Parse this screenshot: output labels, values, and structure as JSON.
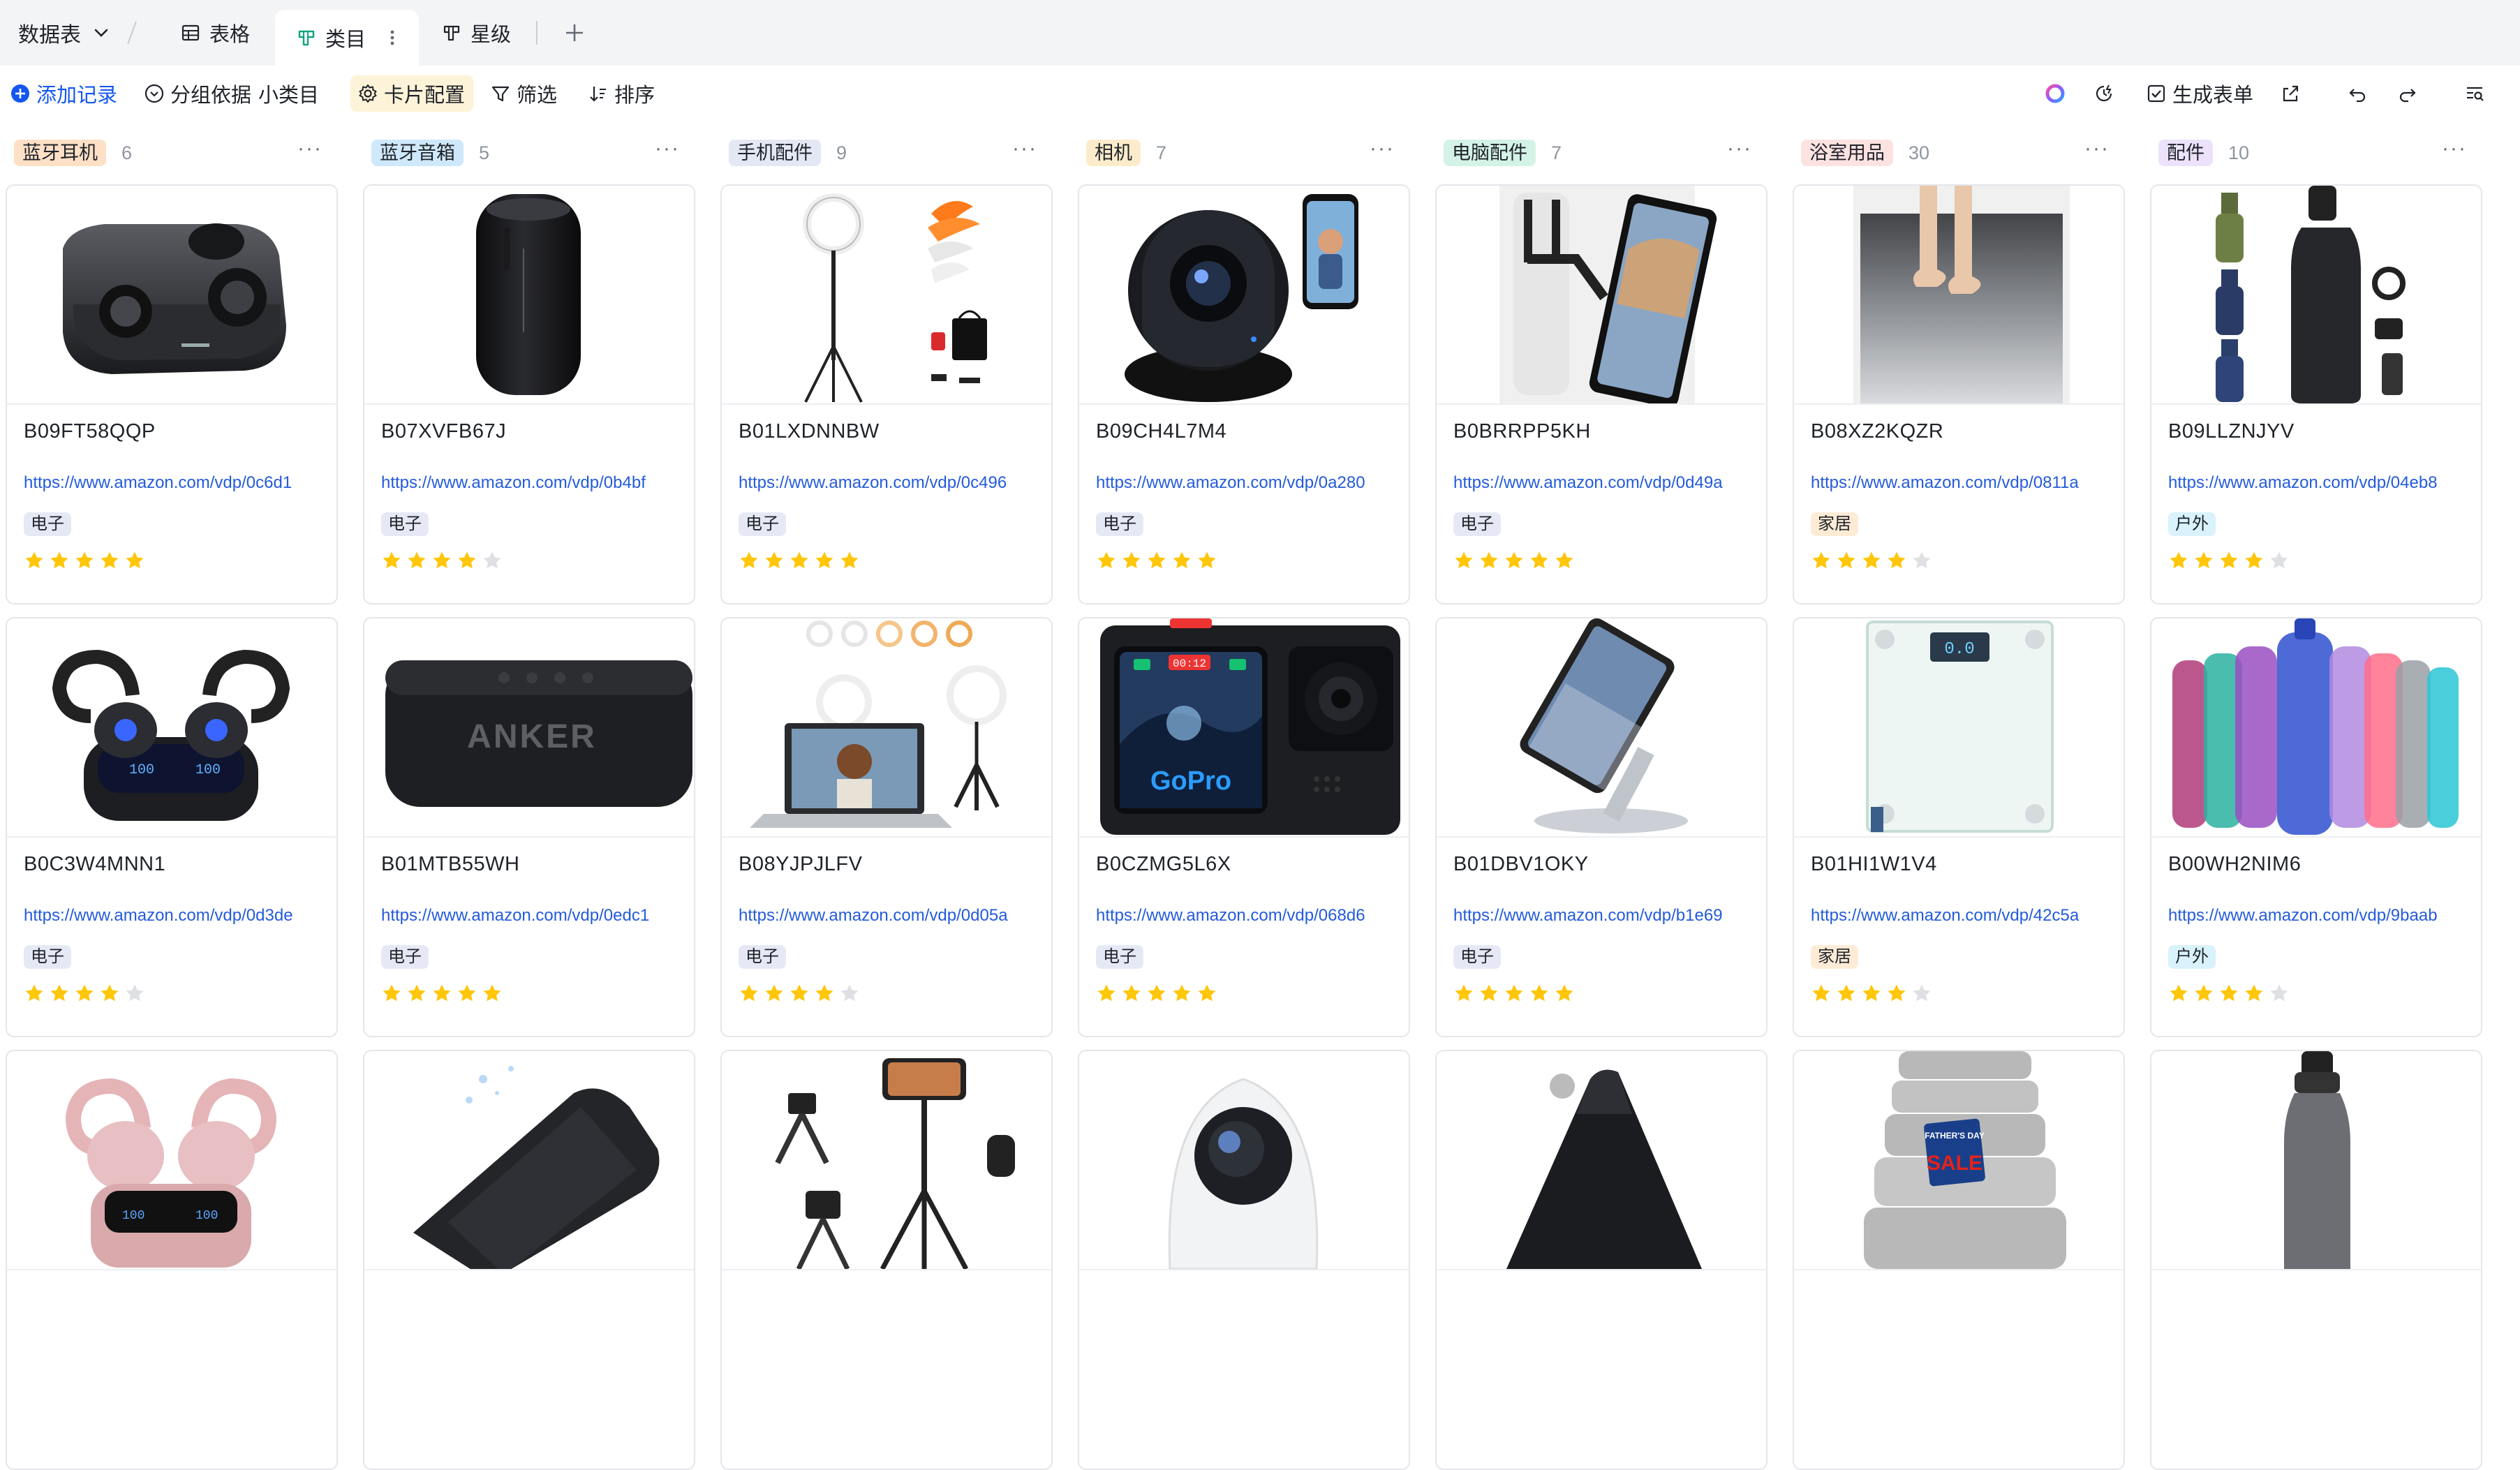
{
  "tabbar": {
    "datatable_label": "数据表",
    "tabs": [
      {
        "label": "表格",
        "icon": "grid-icon",
        "active": false
      },
      {
        "label": "类目",
        "icon": "kanban-icon",
        "active": true
      },
      {
        "label": "星级",
        "icon": "kanban-icon",
        "active": false
      }
    ],
    "add_label": "+"
  },
  "toolbar": {
    "add_record": "添加记录",
    "group_by_prefix": "分组依据",
    "group_by_value": "小类目",
    "card_config": "卡片配置",
    "filter": "筛选",
    "sort": "排序",
    "generate_form": "生成表单"
  },
  "colors": {
    "accent_blue": "#1456f0",
    "star_on": "#ffc60a",
    "star_off": "#dee0e3",
    "tag_electronics_bg": "#e6e9f5",
    "tag_home_bg": "#fdebd6",
    "tag_outdoor_bg": "#d9f2fb"
  },
  "columns": [
    {
      "name": "蓝牙耳机",
      "count": "6",
      "tag_bg": "#fde0c6",
      "tag_fg": "#1f2329",
      "cards": [
        {
          "asin": "B09FT58QQP",
          "link": "https://www.amazon.com/vdp/0c6d1",
          "category": "电子",
          "cat_type": "electronics",
          "rating": 5,
          "image": "earbuds-case-image"
        },
        {
          "asin": "B0C3W4MNN1",
          "link": "https://www.amazon.com/vdp/0d3de",
          "category": "电子",
          "cat_type": "electronics",
          "rating": 4,
          "image": "sport-earbuds-image"
        },
        {
          "image": "pink-earbuds-image"
        }
      ]
    },
    {
      "name": "蓝牙音箱",
      "count": "5",
      "tag_bg": "#cfe8fb",
      "tag_fg": "#1f2329",
      "cards": [
        {
          "asin": "B07XVFB67J",
          "link": "https://www.amazon.com/vdp/0b4bf",
          "category": "电子",
          "cat_type": "electronics",
          "rating": 4,
          "image": "cylinder-speaker-image"
        },
        {
          "asin": "B01MTB55WH",
          "link": "https://www.amazon.com/vdp/0edc1",
          "category": "电子",
          "cat_type": "electronics",
          "rating": 5,
          "image": "anker-speaker-image"
        },
        {
          "image": "waterproof-speaker-image"
        }
      ]
    },
    {
      "name": "手机配件",
      "count": "9",
      "tag_bg": "#e4e8f5",
      "tag_fg": "#1f2329",
      "cards": [
        {
          "asin": "B01LXDNNBW",
          "link": "https://www.amazon.com/vdp/0c496",
          "category": "电子",
          "cat_type": "electronics",
          "rating": 5,
          "image": "ring-light-image"
        },
        {
          "asin": "B08YJPJLFV",
          "link": "https://www.amazon.com/vdp/0d05a",
          "category": "电子",
          "cat_type": "electronics",
          "rating": 4,
          "image": "laptop-ring-light-image"
        },
        {
          "image": "tripod-image"
        }
      ]
    },
    {
      "name": "相机",
      "count": "7",
      "tag_bg": "#fdeccb",
      "tag_fg": "#1f2329",
      "cards": [
        {
          "asin": "B09CH4L7M4",
          "link": "https://www.amazon.com/vdp/0a280",
          "category": "电子",
          "cat_type": "electronics",
          "rating": 5,
          "image": "security-camera-image"
        },
        {
          "asin": "B0CZMG5L6X",
          "link": "https://www.amazon.com/vdp/068d6",
          "category": "电子",
          "cat_type": "electronics",
          "rating": 5,
          "image": "gopro-camera-image"
        },
        {
          "image": "dome-camera-image"
        }
      ]
    },
    {
      "name": "电脑配件",
      "count": "7",
      "tag_bg": "#d4f3e6",
      "tag_fg": "#1f2329",
      "cards": [
        {
          "asin": "B0BRRPP5KH",
          "link": "https://www.amazon.com/vdp/0d49a",
          "category": "电子",
          "cat_type": "electronics",
          "rating": 5,
          "image": "headrest-tablet-mount-image"
        },
        {
          "asin": "B01DBV1OKY",
          "link": "https://www.amazon.com/vdp/b1e69",
          "category": "电子",
          "cat_type": "electronics",
          "rating": 5,
          "image": "tablet-stand-image"
        },
        {
          "image": "foldable-stand-image"
        }
      ]
    },
    {
      "name": "浴室用品",
      "count": "30",
      "tag_bg": "#fde2e2",
      "tag_fg": "#1f2329",
      "cards": [
        {
          "asin": "B08XZ2KQZR",
          "link": "https://www.amazon.com/vdp/0811a",
          "category": "家居",
          "cat_type": "home",
          "rating": 4,
          "image": "bath-mat-image"
        },
        {
          "asin": "B01HI1W1V4",
          "link": "https://www.amazon.com/vdp/42c5a",
          "category": "家居",
          "cat_type": "home",
          "rating": 4,
          "image": "bathroom-scale-image"
        },
        {
          "image": "towel-set-image",
          "sale_text": "SALE",
          "badge_text": "FATHER'S DAY"
        }
      ]
    },
    {
      "name": "配件",
      "count": "10",
      "tag_bg": "#ece2fb",
      "tag_fg": "#1f2329",
      "cards": [
        {
          "asin": "B09LLZNJYV",
          "link": "https://www.amazon.com/vdp/04eb8",
          "category": "户外",
          "cat_type": "outdoor",
          "rating": 4,
          "image": "water-bottle-set-image"
        },
        {
          "asin": "B00WH2NIM6",
          "link": "https://www.amazon.com/vdp/9baab",
          "category": "户外",
          "cat_type": "outdoor",
          "rating": 4,
          "image": "colorful-bottles-image"
        },
        {
          "image": "gray-bottle-image"
        }
      ]
    }
  ],
  "product_text": {
    "anker_logo": "ANKER",
    "gopro_logo": "GoPro",
    "scale_readout": "0.0",
    "gopro_time": "00:12"
  }
}
